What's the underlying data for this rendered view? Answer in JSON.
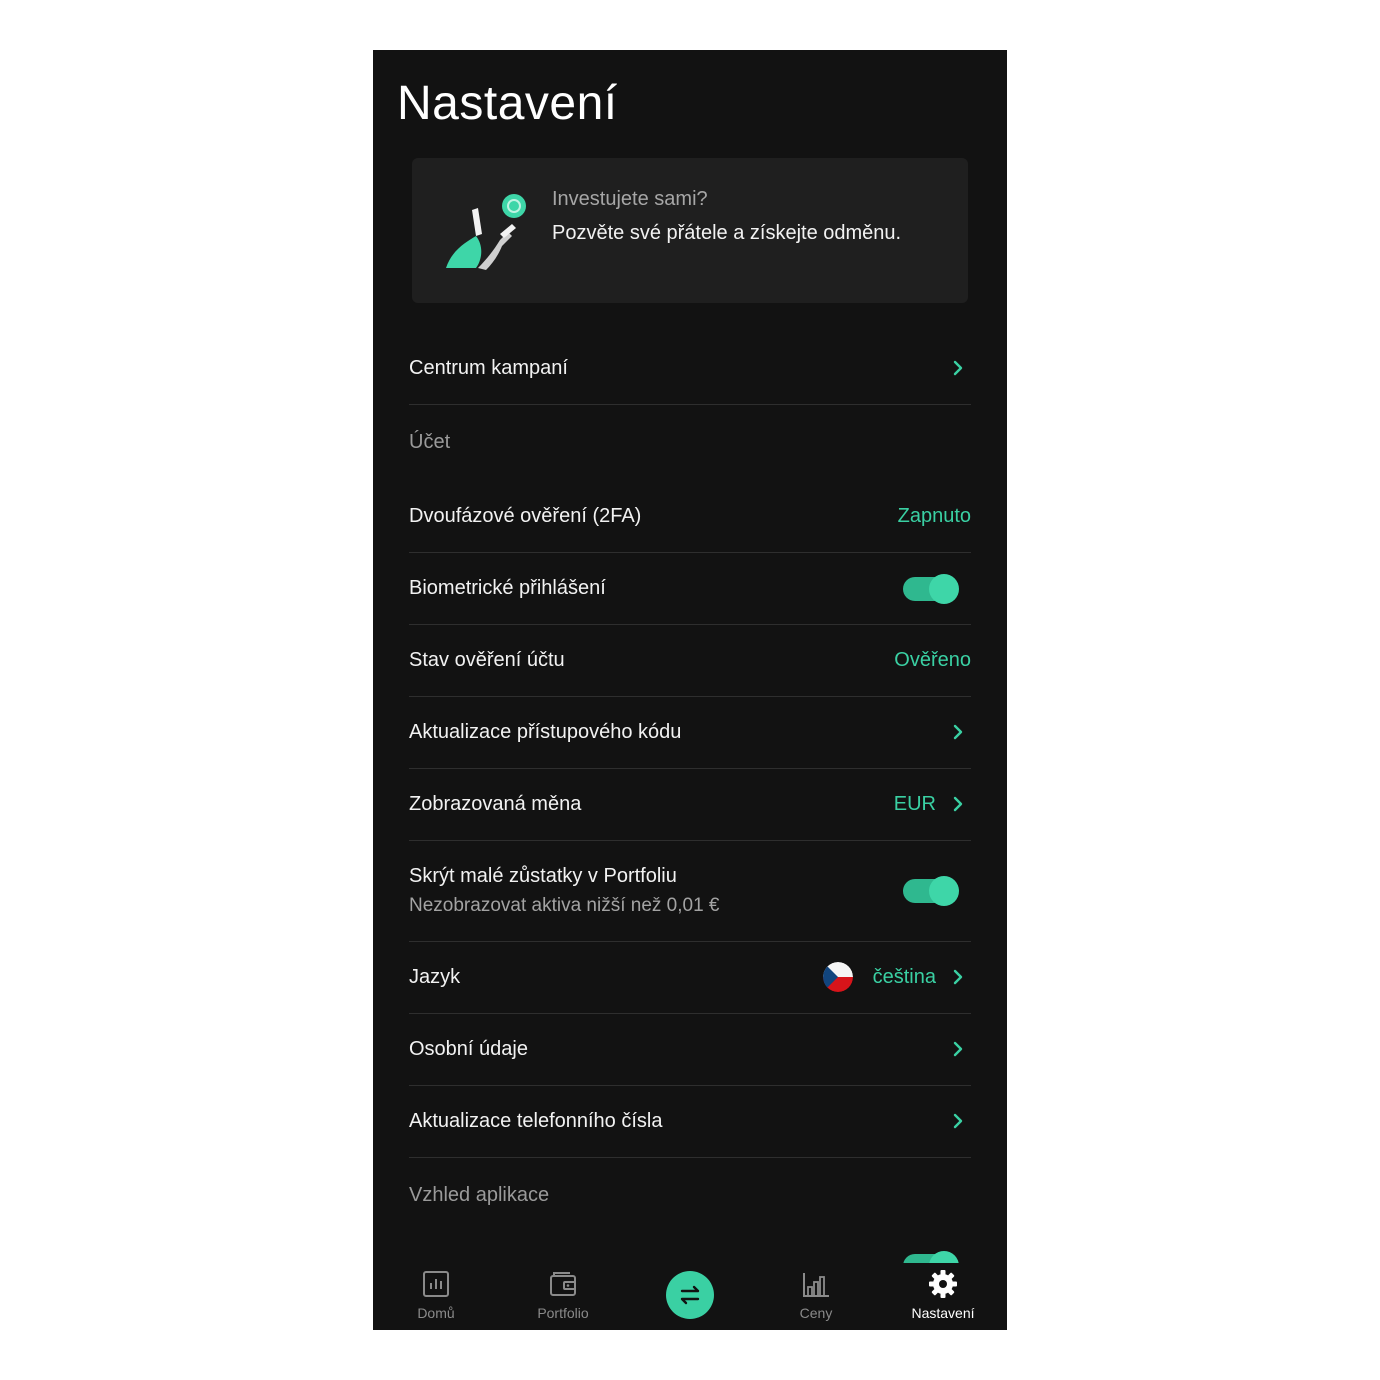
{
  "title": "Nastavení",
  "promo": {
    "question": "Investujete sami?",
    "text": "Pozvěte své přátele a získejte odměnu."
  },
  "rows": {
    "campaigns": "Centrum kampaní",
    "section_account": "Účet",
    "twofa_label": "Dvoufázové ověření (2FA)",
    "twofa_value": "Zapnuto",
    "biometric_label": "Biometrické přihlášení",
    "verify_label": "Stav ověření účtu",
    "verify_value": "Ověřeno",
    "passcode_label": "Aktualizace přístupového kódu",
    "currency_label": "Zobrazovaná měna",
    "currency_value": "EUR",
    "hide_small_label": "Skrýt malé zůstatky v Portfoliu",
    "hide_small_sub": "Nezobrazovat aktiva nižší než 0,01 €",
    "language_label": "Jazyk",
    "language_value": "čeština",
    "personal_label": "Osobní údaje",
    "phone_label": "Aktualizace telefonního čísla",
    "section_appearance": "Vzhled aplikace"
  },
  "toggles": {
    "biometric": true,
    "hide_small": true
  },
  "nav": {
    "home": "Domů",
    "portfolio": "Portfolio",
    "prices": "Ceny",
    "settings": "Nastavení",
    "active": "settings"
  },
  "colors": {
    "accent": "#3ad0a3",
    "background": "#121212",
    "card": "#1f1f1f"
  }
}
